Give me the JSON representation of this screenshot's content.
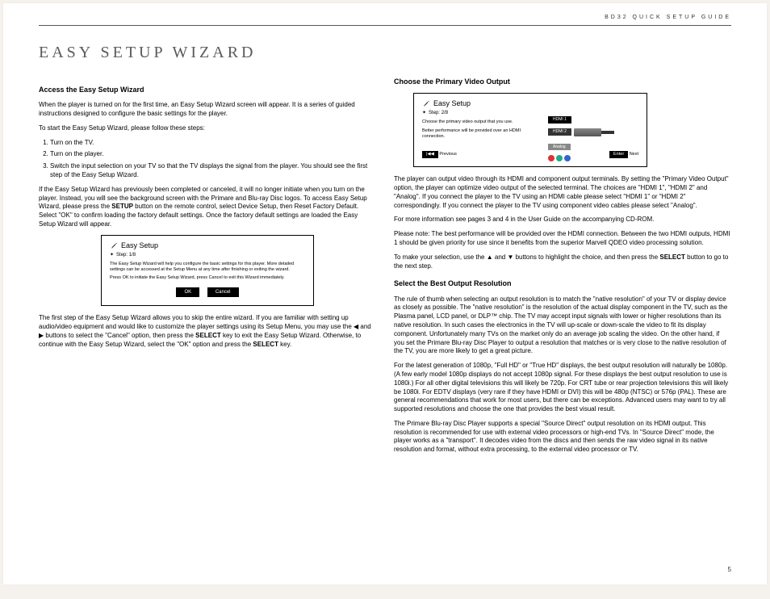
{
  "header": "BD32 QUICK SETUP GUIDE",
  "title": "Easy Setup Wizard",
  "page_number": "5",
  "left": {
    "h_access": "Access the Easy Setup Wizard",
    "p1": "When the player is turned on for the first time, an Easy Setup Wizard screen will appear. It is a series of guided instructions designed to configure the basic settings for the player.",
    "p2": "To start the Easy Setup Wizard, please follow these steps:",
    "steps": {
      "s1": "Turn on the TV.",
      "s2": "Turn on the player.",
      "s3": "Switch the input selection on your TV so that the TV displays the signal from the player. You should see the first step of the Easy Setup Wizard."
    },
    "p3a": "If the Easy Setup Wizard has previously been completed or canceled, it will no longer initiate when you turn on the player. Instead, you will see the background screen with the Primare and Blu-ray Disc logos. To access Easy Setup Wizard, please press the ",
    "p3b": "SETUP",
    "p3c": " button on the remote control, select Device Setup, then Reset Factory Default. Select \"OK\" to confirm loading the factory default settings. Once the factory default settings are loaded the Easy Setup Wizard will appear.",
    "dlg": {
      "title": "Easy Setup",
      "step": "Step: 1/8",
      "b1": "The Easy Setup Wizard will help you configure the basic settings for this player. More detailed settings can be accessed at the Setup Menu at any time after finishing or exiting the wizard.",
      "b2": "Press OK to initiate the Easy Setup Wizard, press Cancel to exit this Wizard immediately.",
      "ok": "OK",
      "cancel": "Cancel"
    },
    "p4a": "The first step of the Easy Setup Wizard allows you to skip the entire wizard. If you are familiar with setting up audio/video equipment and would like to customize the player settings using its Setup Menu, you may use the ◀ and ▶ buttons to select the \"Cancel\" option, then press the ",
    "p4b": "SELECT",
    "p4c": " key to exit the Easy Setup Wizard. Otherwise, to continue with the Easy Setup Wizard, select the \"OK\" option and press the ",
    "p4d": "SELECT",
    "p4e": " key."
  },
  "right": {
    "h_choose": "Choose the Primary Video Output",
    "dlg": {
      "title": "Easy Setup",
      "step": "Step: 2/8",
      "b1": "Choose the primary video output that you use.",
      "b2": "Better performance will be provided over an HDMI connection.",
      "hdmi1": "HDMI 1",
      "hdmi2": "HDMI 2",
      "analog": "Analog",
      "prev_icon": "|◀◀",
      "prev": "Previous",
      "enter": "Enter",
      "next": "Next"
    },
    "p1": "The player can output video through its HDMI and component output terminals. By setting the \"Primary Video Output\" option, the player can optimize video output of the selected terminal. The choices are \"HDMI 1\", \"HDMI 2\" and \"Analog\". If you connect the player to the TV using an HDMI cable please select \"HDMI 1\" or \"HDMI 2\" correspondingly. If you connect the player to the TV using component video cables please select \"Analog\".",
    "p2": "For more information see pages 3 and 4 in the User Guide on the accompanying CD-ROM.",
    "p3": "Please note: The best performance will be provided over the HDMI connection. Between the two HDMI outputs, HDMI 1 should be given priority for use since it benefits from the superior Marvell QDEO video processing solution.",
    "p4a": "To make your selection, use the ▲ and ▼ buttons to highlight the choice, and then press the ",
    "p4b": "SELECT",
    "p4c": " button to go to the next step.",
    "h_res": "Select the Best Output Resolution",
    "p5": "The rule of thumb when selecting an output resolution is to match the \"native resolution\" of your TV or display device as closely as possible. The \"native resolution\" is the resolution of the actual display component in the TV, such as the Plasma panel, LCD panel, or DLP™ chip. The TV may accept input signals with lower or higher resolutions than its native resolution. In such cases the electronics in the TV will up-scale or down-scale the video to fit its display component. Unfortunately many TVs on the market only do an average job scaling the video. On the other hand, if you set the Primare Blu-ray Disc Player to output a resolution that matches or is very close to the native resolution of the TV, you are more likely to get a great picture.",
    "p6": "For the latest generation of 1080p, \"Full HD\" or \"True HD\" displays, the best output resolution will naturally be 1080p. (A few early model 1080p displays do not accept 1080p signal. For these displays the best output resolution to use is 1080i.) For all other digital televisions this will likely be 720p. For CRT tube or rear projection televisions this will likely be 1080i. For EDTV displays (very rare if they have HDMI or DVI) this will be 480p (NTSC) or 576p (PAL). These are general recommendations that work for most users, but there can be exceptions. Advanced users may want to try all supported resolutions and choose the one that provides the best visual result.",
    "p7": "The Primare Blu-ray Disc Player supports a special \"Source Direct\" output resolution on its HDMI output. This resolution is recommended for use with external video processors or high-end TVs. In \"Source Direct\" mode, the player works as a \"transport\". It decodes video from the discs and then sends the raw video signal in its native resolution and format, without extra processing, to the external video processor or TV."
  }
}
